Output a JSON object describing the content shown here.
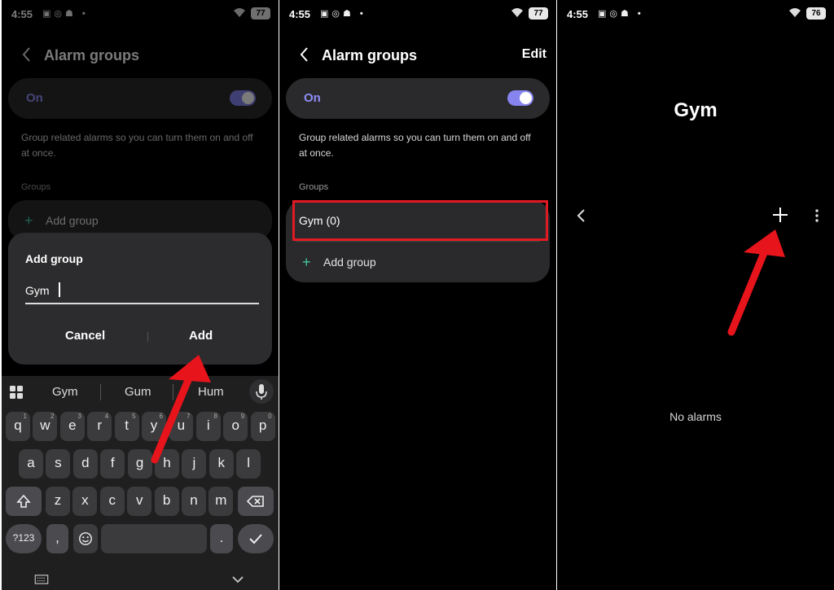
{
  "status": {
    "time": "4:55",
    "battery_p1": "77",
    "battery_p2": "77",
    "battery_p3": "76"
  },
  "header": {
    "title": "Alarm groups",
    "edit": "Edit"
  },
  "toggle": {
    "label": "On"
  },
  "description": "Group related alarms so you can turn them on and off at once.",
  "groups": {
    "section": "Groups",
    "add_group": "Add group",
    "gym_item": "Gym (0)"
  },
  "dialog": {
    "title": "Add group",
    "input_value": "Gym",
    "cancel": "Cancel",
    "add": "Add"
  },
  "keyboard": {
    "suggestions": [
      "Gym",
      "Gum",
      "Hum"
    ],
    "row1": [
      "q",
      "w",
      "e",
      "r",
      "t",
      "y",
      "u",
      "i",
      "o",
      "p"
    ],
    "row1_hints": [
      "1",
      "2",
      "3",
      "4",
      "5",
      "6",
      "7",
      "8",
      "9",
      "0"
    ],
    "row2": [
      "a",
      "s",
      "d",
      "f",
      "g",
      "h",
      "j",
      "k",
      "l"
    ],
    "row3": [
      "z",
      "x",
      "c",
      "v",
      "b",
      "n",
      "m"
    ],
    "symbols_key": "?123",
    "comma": ",",
    "period": "."
  },
  "gym_screen": {
    "title": "Gym",
    "empty": "No alarms"
  },
  "colors": {
    "accent": "#8784f0",
    "plus_green": "#44c8a0",
    "highlight_red": "#e01a22",
    "arrow_red": "#e8141c"
  },
  "icons": [
    "back-arrow-icon",
    "wifi-icon",
    "battery-icon",
    "plus-icon",
    "grid-icon",
    "mic-icon",
    "shift-icon",
    "backspace-icon",
    "emoji-icon",
    "check-icon",
    "more-vert-icon",
    "keyboard-icon",
    "chevron-down-icon"
  ]
}
